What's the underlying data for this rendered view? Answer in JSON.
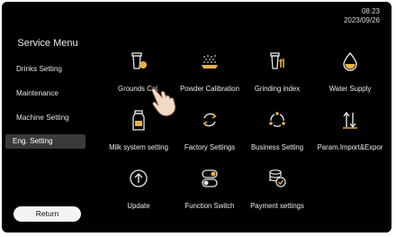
{
  "clock": {
    "time": "08:23",
    "date": "2023/09/26"
  },
  "sidebar": {
    "title": "Service Menu",
    "items": [
      {
        "label": "Drinks Setting"
      },
      {
        "label": "Maintenance"
      },
      {
        "label": "Machine Setting"
      },
      {
        "label": "Eng. Setting",
        "active": true
      }
    ],
    "return_label": "Return"
  },
  "grid": {
    "items": [
      {
        "label": "Grounds Cal.",
        "icon": "grounds-calibration-icon"
      },
      {
        "label": "Powder Calibration",
        "icon": "powder-calibration-icon"
      },
      {
        "label": "Grinding index",
        "icon": "grinding-index-icon"
      },
      {
        "label": "Water Supply",
        "icon": "water-drop-icon"
      },
      {
        "label": "Milk system setting",
        "icon": "milk-bottle-icon"
      },
      {
        "label": "Factory Settings",
        "icon": "refresh-icon"
      },
      {
        "label": "Business Setting",
        "icon": "business-cycle-icon"
      },
      {
        "label": "Param.Import&Expor",
        "icon": "import-export-icon"
      },
      {
        "label": "Update",
        "icon": "upload-arrow-icon"
      },
      {
        "label": "Function Switch",
        "icon": "toggle-switch-icon"
      },
      {
        "label": "Payment settings",
        "icon": "coin-stack-icon"
      }
    ]
  },
  "colors": {
    "background": "#000000",
    "accent": "#e8b04a",
    "text": "#ececec"
  }
}
